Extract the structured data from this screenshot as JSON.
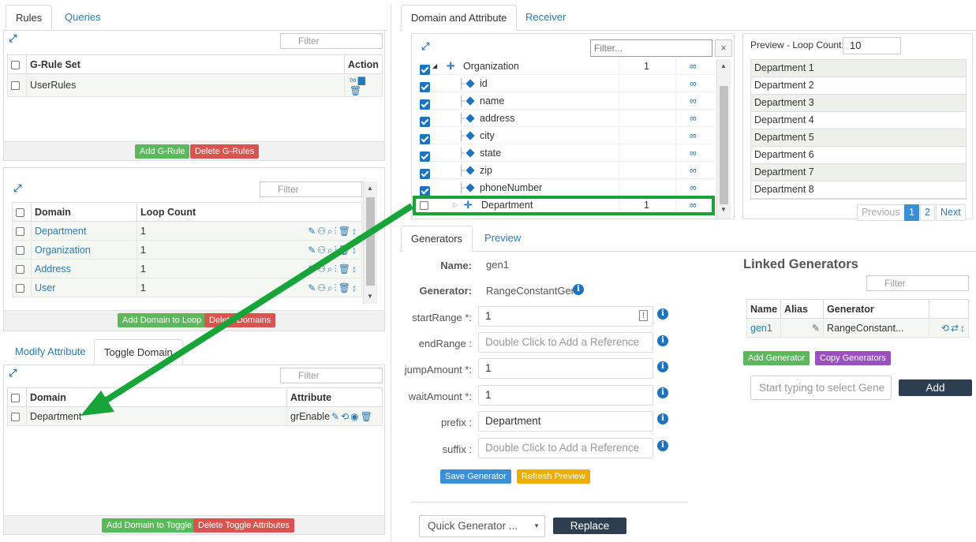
{
  "left_tabs": [
    "Rules",
    "Queries"
  ],
  "rules_panel": {
    "filter_placeholder": "Filter",
    "col_set": "G-Rule Set",
    "col_action": "Action",
    "rows": [
      "UserRules"
    ],
    "add_btn": "Add G-Rule",
    "delete_btn": "Delete G-Rules"
  },
  "loop_panel": {
    "filter_placeholder": "Filter",
    "col_domain": "Domain",
    "col_loop": "Loop Count",
    "rows": [
      {
        "domain": "Department",
        "count": "1"
      },
      {
        "domain": "Organization",
        "count": "1"
      },
      {
        "domain": "Address",
        "count": "1"
      },
      {
        "domain": "User",
        "count": "1"
      }
    ],
    "add_btn": "Add Domain to Loop",
    "delete_btn": "Delete Domains"
  },
  "bottom_tabs": [
    "Modify Attribute",
    "Toggle Domain"
  ],
  "toggle_panel": {
    "filter_placeholder": "Filter",
    "col_domain": "Domain",
    "col_attribute": "Attribute",
    "rows": [
      {
        "domain": "Department",
        "attribute": "grEnable"
      }
    ],
    "add_btn": "Add Domain to Toggle",
    "delete_btn": "Delete Toggle Attributes"
  },
  "right_tabs": [
    "Domain and Attribute",
    "Receiver"
  ],
  "tree": {
    "filter_placeholder": "Filter...",
    "clear": "×",
    "nodes": [
      {
        "label": "Organization",
        "count": "1",
        "link": "∞"
      },
      {
        "label": "id",
        "link": "∞"
      },
      {
        "label": "name",
        "link": "∞"
      },
      {
        "label": "address",
        "link": "∞"
      },
      {
        "label": "city",
        "link": "∞"
      },
      {
        "label": "state",
        "link": "∞"
      },
      {
        "label": "zip",
        "link": "∞"
      },
      {
        "label": "phoneNumber",
        "link": "∞"
      },
      {
        "label": "Department",
        "count": "1",
        "link": "∞"
      }
    ]
  },
  "preview": {
    "label": "Preview - Loop Count:",
    "loop_value": "10",
    "rows": [
      "Department 1",
      "Department 2",
      "Department 3",
      "Department 4",
      "Department 5",
      "Department 6",
      "Department 7",
      "Department 8"
    ],
    "prev": "Previous",
    "pages": [
      "1",
      "2"
    ],
    "next": "Next"
  },
  "gen_tabs": [
    "Generators",
    "Preview"
  ],
  "generator": {
    "name_label": "Name:",
    "name_value": "gen1",
    "gen_label": "Generator:",
    "gen_value": "RangeConstantGen",
    "fields": [
      {
        "label": "startRange *:",
        "value": "1",
        "placeholder": false
      },
      {
        "label": "endRange :",
        "value": "Double Click to Add a Reference",
        "placeholder": true
      },
      {
        "label": "jumpAmount *:",
        "value": "1",
        "placeholder": false
      },
      {
        "label": "waitAmount *:",
        "value": "1",
        "placeholder": false
      },
      {
        "label": "prefix :",
        "value": "Department",
        "placeholder": false
      },
      {
        "label": "suffix :",
        "value": "Double Click to Add a Reference",
        "placeholder": true
      }
    ],
    "save_btn": "Save Generator",
    "refresh_btn": "Refresh Preview",
    "quick_select": "Quick Generator ...",
    "replace_btn": "Replace"
  },
  "linked": {
    "title": "Linked Generators",
    "filter_placeholder": "Filter",
    "col_name": "Name",
    "col_alias": "Alias",
    "col_generator": "Generator",
    "rows": [
      {
        "name": "gen1",
        "generator": "RangeConstant..."
      }
    ],
    "add_btn": "Add Generator",
    "copy_btn": "Copy Generators",
    "select_placeholder": "Start typing to select Gene",
    "add_main_btn": "Add"
  },
  "colors": {
    "accent": "#2a7ab9",
    "highlight": "#17a53a",
    "green": "#5cb85c",
    "red": "#d9534f"
  }
}
